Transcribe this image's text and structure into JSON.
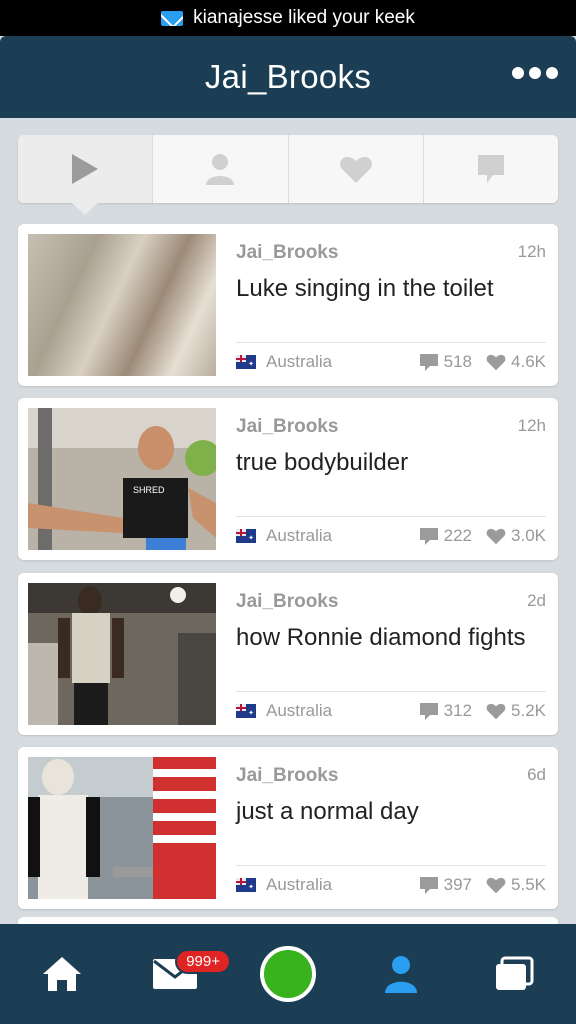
{
  "notification": {
    "text": "kianajesse liked your keek"
  },
  "header": {
    "title": "Jai_Brooks"
  },
  "tabs": [
    "video-icon",
    "profile-icon",
    "likes-icon",
    "comments-icon"
  ],
  "feed": [
    {
      "author": "Jai_Brooks",
      "age": "12h",
      "caption": "Luke singing in the toilet",
      "location": "Australia",
      "comments": "518",
      "likes": "4.6K"
    },
    {
      "author": "Jai_Brooks",
      "age": "12h",
      "caption": "true bodybuilder",
      "location": "Australia",
      "comments": "222",
      "likes": "3.0K"
    },
    {
      "author": "Jai_Brooks",
      "age": "2d",
      "caption": "how Ronnie diamond fights",
      "location": "Australia",
      "comments": "312",
      "likes": "5.2K"
    },
    {
      "author": "Jai_Brooks",
      "age": "6d",
      "caption": "just a normal day",
      "location": "Australia",
      "comments": "397",
      "likes": "5.5K"
    }
  ],
  "tabbar": {
    "inbox_badge": "999+"
  },
  "colors": {
    "header": "#1c3e55",
    "accent_blue": "#2a9ef0",
    "record_green": "#39b31d",
    "badge_red": "#e02424"
  }
}
